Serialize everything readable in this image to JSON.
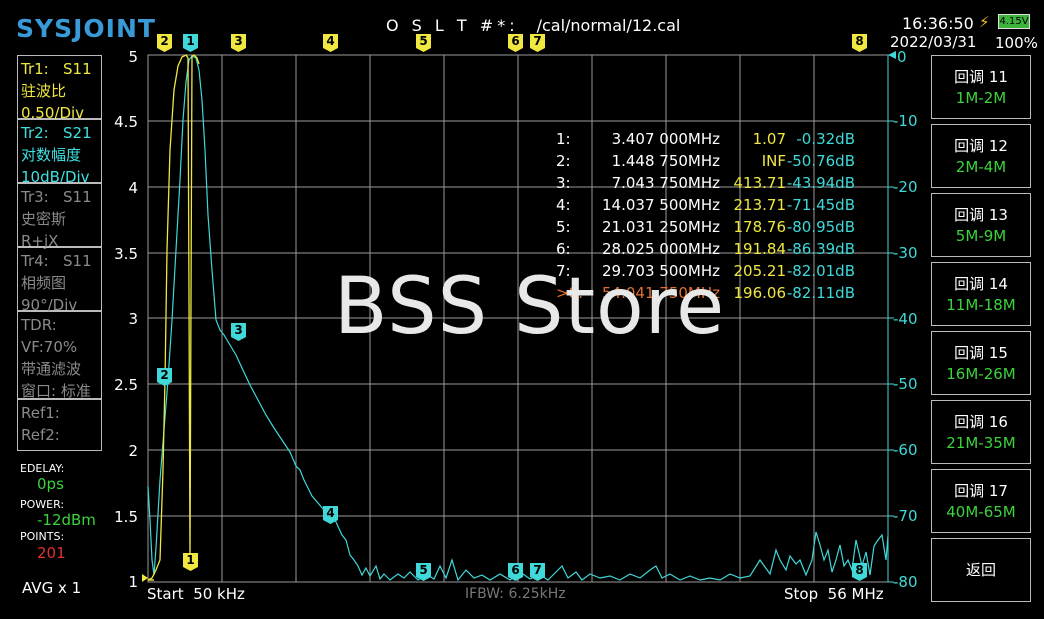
{
  "header": {
    "logo": "SYSJOINT",
    "status_prefix": "O S L T #*:",
    "cal_path": "/cal/normal/12.cal",
    "time": "16:36:50",
    "date": "2022/03/31",
    "battery_voltage": "4.15V",
    "battery_percent": "100%"
  },
  "traces": [
    {
      "line1": "Tr1:   S11",
      "line2": "驻波比",
      "line3": "0.50/Div",
      "state": "active-yellow"
    },
    {
      "line1": "Tr2:   S21",
      "line2": "对数幅度",
      "line3": "10dB/Div",
      "state": "active-cyan"
    },
    {
      "line1": "Tr3:   S11",
      "line2": "史密斯",
      "line3": "R+jX",
      "state": "inactive"
    },
    {
      "line1": "Tr4:   S11",
      "line2": "相频图",
      "line3": "90°/Div",
      "state": "inactive"
    }
  ],
  "tdr": {
    "line1": "TDR:",
    "line2": "VF:70%",
    "line3": "带通滤波",
    "line4": "窗口: 标准"
  },
  "refs": {
    "ref1": "Ref1:",
    "ref2": "Ref2:"
  },
  "settings": {
    "edelay_label": "EDELAY:",
    "edelay_value": "0ps",
    "power_label": "POWER:",
    "power_value": "-12dBm",
    "points_label": "POINTS:",
    "points_value": "201",
    "avg": "AVG x 1"
  },
  "axes": {
    "left_ticks": [
      "5",
      "4.5",
      "4",
      "3.5",
      "3",
      "2.5",
      "2",
      "1.5",
      "1"
    ],
    "right_ticks": [
      "0",
      "-10",
      "-20",
      "-30",
      "-40",
      "-50",
      "-60",
      "-70",
      "-80"
    ]
  },
  "footer": {
    "start_label": "Start",
    "start_value": "50 kHz",
    "ifbw": "IFBW: 6.25kHz",
    "stop_label": "Stop",
    "stop_value": "56 MHz"
  },
  "markers": [
    {
      "idx": "1:",
      "freq": "3.407 000MHz",
      "val": "1.07",
      "db": "-0.32dB",
      "selected": false
    },
    {
      "idx": "2:",
      "freq": "1.448 750MHz",
      "val": "INF",
      "db": "-50.76dB",
      "selected": false
    },
    {
      "idx": "3:",
      "freq": "7.043 750MHz",
      "val": "413.71",
      "db": "-43.94dB",
      "selected": false
    },
    {
      "idx": "4:",
      "freq": "14.037 500MHz",
      "val": "213.71",
      "db": "-71.45dB",
      "selected": false
    },
    {
      "idx": "5:",
      "freq": "21.031 250MHz",
      "val": "178.76",
      "db": "-80.95dB",
      "selected": false
    },
    {
      "idx": "6:",
      "freq": "28.025 000MHz",
      "val": "191.84",
      "db": "-86.39dB",
      "selected": false
    },
    {
      "idx": "7:",
      "freq": "29.703 500MHz",
      "val": "205.21",
      "db": "-82.01dB",
      "selected": false
    },
    {
      "idx": ">8:",
      "freq": "54.041 750MHz",
      "val": "196.06",
      "db": "-82.11dB",
      "selected": true
    }
  ],
  "watermark": "BSS Store",
  "buttons": [
    {
      "label": "回调 11",
      "sub": "1M-2M"
    },
    {
      "label": "回调 12",
      "sub": "2M-4M"
    },
    {
      "label": "回调 13",
      "sub": "5M-9M"
    },
    {
      "label": "回调 14",
      "sub": "11M-18M"
    },
    {
      "label": "回调 15",
      "sub": "16M-26M"
    },
    {
      "label": "回调 16",
      "sub": "21M-35M"
    },
    {
      "label": "回调 17",
      "sub": "40M-65M"
    },
    {
      "label": "返回",
      "sub": ""
    }
  ],
  "marker_flags": [
    "1",
    "2",
    "3",
    "4",
    "5",
    "6",
    "7",
    "8"
  ],
  "colors": {
    "accent_blue": "#3a9ad8",
    "trace_yellow": "#f0e840",
    "trace_cyan": "#40d8d8",
    "value_green": "#3cd23c",
    "points_red": "#e03030",
    "selected_orange": "#e07030"
  }
}
